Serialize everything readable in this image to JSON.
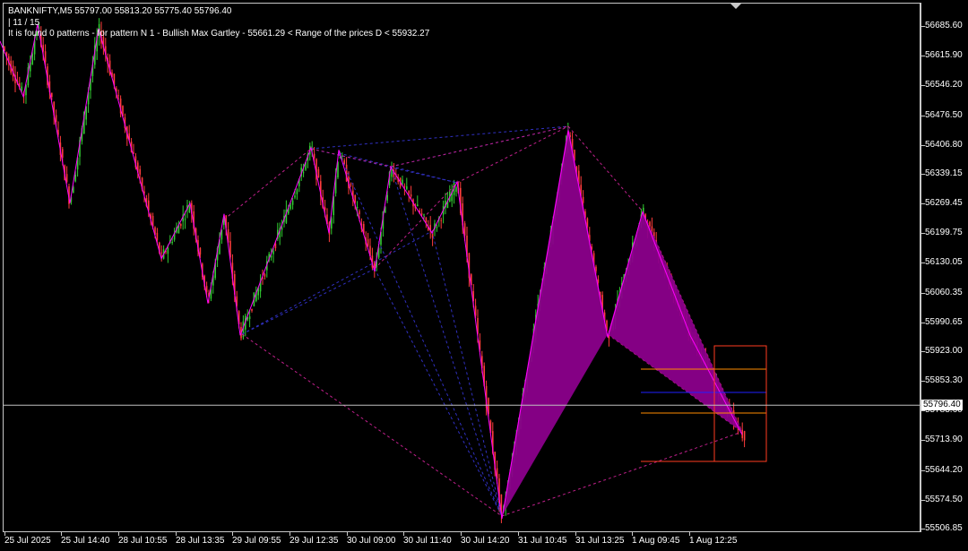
{
  "header": {
    "symbol_line": "BANKNIFTY,M5  55797.00 55813.20 55775.40 55796.40",
    "counter": "| 11 / 15",
    "pattern_info": "It is found 0 patterns  -  for pattern N 1 - Bullish Max Gartley  - 55661.29 < Range of the prices D < 55932.27"
  },
  "price_axis": {
    "labels": [
      "56685.60",
      "56615.90",
      "56546.20",
      "56476.50",
      "56406.80",
      "56339.15",
      "56269.45",
      "56199.75",
      "56130.05",
      "56060.35",
      "55990.65",
      "55923.00",
      "55853.30",
      "55783.60",
      "55713.90",
      "55644.20",
      "55574.50",
      "55506.85"
    ],
    "current_price": "55796.40"
  },
  "time_axis": {
    "labels": [
      "25 Jul 2025",
      "25 Jul 14:40",
      "28 Jul 10:55",
      "28 Jul 13:35",
      "29 Jul 09:55",
      "29 Jul 12:35",
      "30 Jul 09:00",
      "30 Jul 11:40",
      "30 Jul 14:20",
      "31 Jul 10:45",
      "31 Jul 13:25",
      "1 Aug 09:45",
      "1 Aug 12:25"
    ]
  },
  "colors": {
    "background": "#000000",
    "bull_candle": "#32cd32",
    "bear_candle": "#ff3c3c",
    "zigzag": "#ff00ff",
    "pattern_fill": "#8b008b",
    "guide_blue": "#3030c0",
    "guide_pink": "#c0208c",
    "target_orange": "#ff8c00",
    "target_box": "#ff3c20",
    "price_line": "#c0c0c0",
    "level_blue": "#2020ff"
  },
  "chart_data": {
    "type": "candlestick",
    "symbol": "BANKNIFTY",
    "timeframe": "M5",
    "ohlc_last": {
      "open": 55797.0,
      "high": 55813.2,
      "low": 55775.4,
      "close": 55796.4
    },
    "pattern": {
      "name": "Bullish Max Gartley",
      "X": {
        "time": "30 Jul 14:20",
        "price": 55530
      },
      "A": {
        "time": "31 Jul 13:25",
        "price": 56440
      },
      "B": {
        "time": "1 Aug 09:00",
        "price": 55955
      },
      "C": {
        "time": "1 Aug 09:45",
        "price": 56250
      },
      "D": {
        "time": "1 Aug 14:00",
        "price": 55727
      },
      "d_range_low": 55661.29,
      "d_range_high": 55932.27
    },
    "zigzag": [
      [
        0,
        56650
      ],
      [
        26,
        56520
      ],
      [
        42,
        56690
      ],
      [
        78,
        56270
      ],
      [
        110,
        56680
      ],
      [
        180,
        56140
      ],
      [
        212,
        56270
      ],
      [
        232,
        56035
      ],
      [
        250,
        56245
      ],
      [
        268,
        55960
      ],
      [
        347,
        56400
      ],
      [
        367,
        56200
      ],
      [
        378,
        56395
      ],
      [
        418,
        56110
      ],
      [
        436,
        56355
      ],
      [
        482,
        56200
      ],
      [
        510,
        56320
      ],
      [
        560,
        55530
      ],
      [
        634,
        56440
      ],
      [
        678,
        55955
      ],
      [
        717,
        56250
      ],
      [
        770,
        55960
      ],
      [
        828,
        55727
      ]
    ],
    "ylim": [
      55506.85,
      56685.6
    ]
  }
}
